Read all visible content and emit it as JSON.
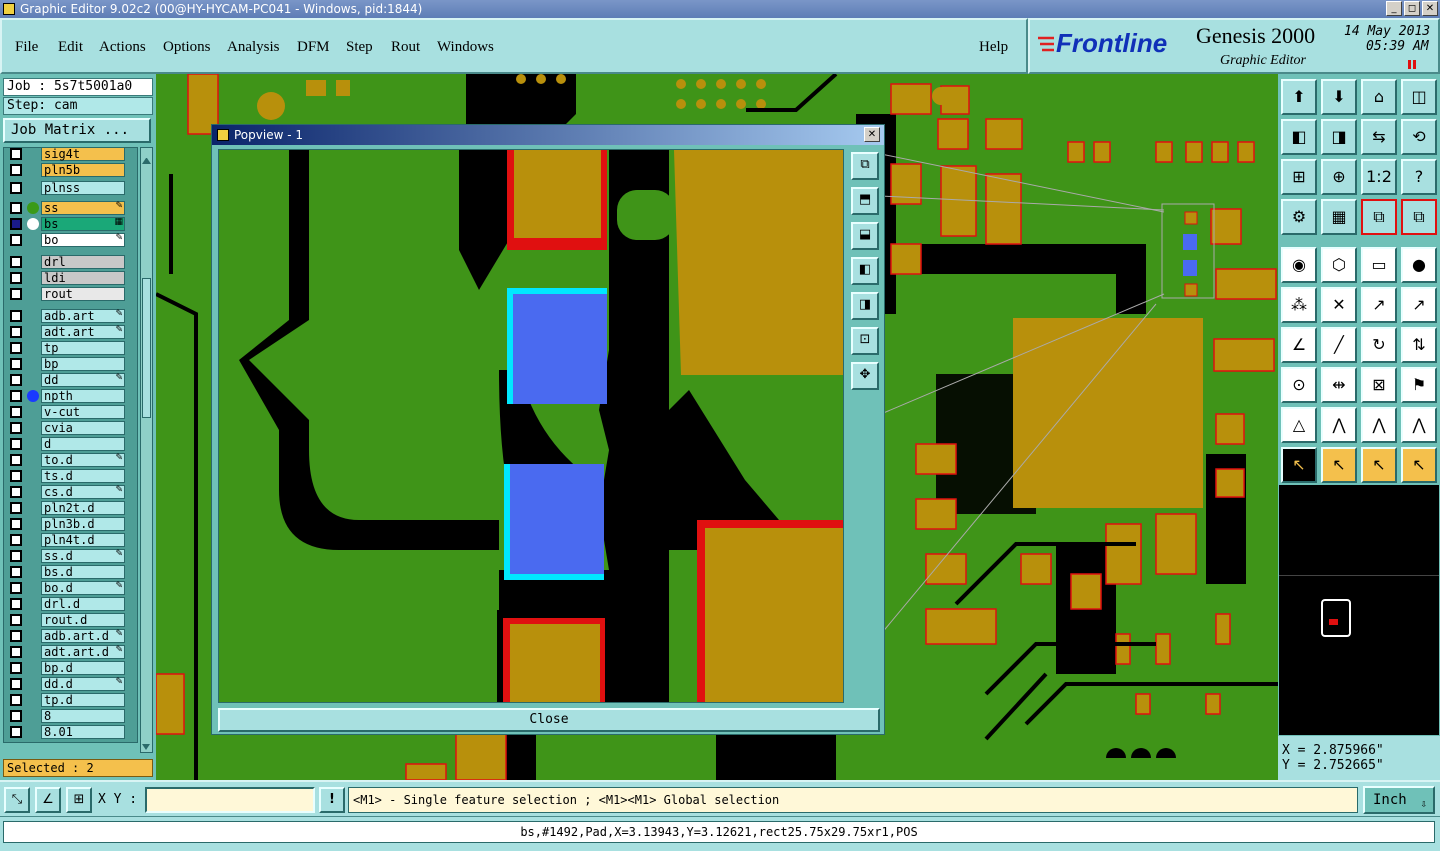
{
  "window": {
    "title": "Graphic Editor 9.02c2 (00@HY-HYCAM-PC041 - Windows, pid:1844)",
    "buttons": [
      "_",
      "◻",
      "✕"
    ]
  },
  "menu": {
    "file": "File",
    "edit": "Edit",
    "actions": "Actions",
    "options": "Options",
    "analysis": "Analysis",
    "dfm": "DFM",
    "step": "Step",
    "rout": "Rout",
    "windows": "Windows",
    "help": "Help"
  },
  "brand": {
    "logo": "Frontline",
    "product": "Genesis 2000",
    "subtitle": "Graphic Editor",
    "date": "14 May 2013",
    "time": "05:39 AM"
  },
  "job": {
    "job_label": "Job : 5s7t5001a0",
    "step_label": "Step: cam",
    "matrix_button": "Job Matrix ..."
  },
  "layers": [
    {
      "name": "sig4t",
      "color": "#f4c04c"
    },
    {
      "name": "pln5b",
      "color": "#f4c04c"
    },
    {
      "name": "plnss",
      "color": "#b0e8e8"
    },
    {
      "name": "ss",
      "color": "#f4c04c",
      "dot": "#3a9a18",
      "mark": "✎"
    },
    {
      "name": "bs",
      "color": "#1aa878",
      "dot": "#ffffff",
      "mark": "▦"
    },
    {
      "name": "bo",
      "color": "#ffffff",
      "mark": "✎"
    },
    {
      "name": "drl",
      "color": "#c8c8c8"
    },
    {
      "name": "ldi",
      "color": "#c8c8c8"
    },
    {
      "name": "rout",
      "color": "#e8e8e8"
    },
    {
      "name": "adb.art",
      "color": "#b0e8e8",
      "mark": "✎"
    },
    {
      "name": "adt.art",
      "color": "#b0e8e8",
      "mark": "✎"
    },
    {
      "name": "tp",
      "color": "#b0e8e8"
    },
    {
      "name": "bp",
      "color": "#b0e8e8"
    },
    {
      "name": "dd",
      "color": "#b0e8e8",
      "mark": "✎"
    },
    {
      "name": "npth",
      "color": "#b0e8e8",
      "dot": "#1a3aff"
    },
    {
      "name": "v-cut",
      "color": "#b0e8e8"
    },
    {
      "name": "cvia",
      "color": "#b0e8e8"
    },
    {
      "name": "d",
      "color": "#b0e8e8"
    },
    {
      "name": "to.d",
      "color": "#b0e8e8",
      "mark": "✎"
    },
    {
      "name": "ts.d",
      "color": "#b0e8e8"
    },
    {
      "name": "cs.d",
      "color": "#b0e8e8",
      "mark": "✎"
    },
    {
      "name": "pln2t.d",
      "color": "#b0e8e8"
    },
    {
      "name": "pln3b.d",
      "color": "#b0e8e8"
    },
    {
      "name": "pln4t.d",
      "color": "#b0e8e8"
    },
    {
      "name": "ss.d",
      "color": "#b0e8e8",
      "mark": "✎"
    },
    {
      "name": "bs.d",
      "color": "#b0e8e8"
    },
    {
      "name": "bo.d",
      "color": "#b0e8e8",
      "mark": "✎"
    },
    {
      "name": "drl.d",
      "color": "#b0e8e8"
    },
    {
      "name": "rout.d",
      "color": "#b0e8e8"
    },
    {
      "name": "adb.art.d",
      "color": "#b0e8e8",
      "mark": "✎"
    },
    {
      "name": "adt.art.d",
      "color": "#b0e8e8",
      "mark": "✎"
    },
    {
      "name": "bp.d",
      "color": "#b0e8e8"
    },
    {
      "name": "dd.d",
      "color": "#b0e8e8",
      "mark": "✎"
    },
    {
      "name": "tp.d",
      "color": "#b0e8e8"
    },
    {
      "name": "8",
      "color": "#b0e8e8"
    },
    {
      "name": "8.01",
      "color": "#b0e8e8"
    }
  ],
  "selected_label": "Selected : 2",
  "popview": {
    "title": "Popview - 1",
    "close_label": "Close",
    "close_icon": "✕"
  },
  "coords": {
    "x": "X = 2.875966\"",
    "y": "Y = 2.752665\""
  },
  "bottom": {
    "xy_label": "X Y :",
    "xy_value": "",
    "prompt": "<M1> - Single feature selection ; <M1><M1> Global selection",
    "unit": "Inch",
    "warn_icon": "!"
  },
  "status": "bs,#1492,Pad,X=3.13943,Y=3.12621,rect25.75x29.75xr1,POS",
  "colors": {
    "board": "#3f9418",
    "copper": "#b8900c",
    "selected": "#4a6af0",
    "highlight": "#00e8ff",
    "panel": "#6fc1b8"
  }
}
